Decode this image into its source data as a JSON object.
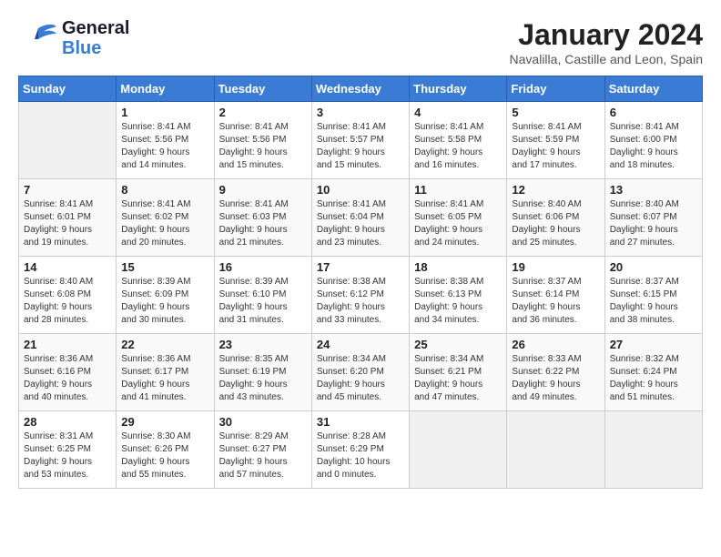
{
  "header": {
    "logo_line1": "General",
    "logo_line2": "Blue",
    "month_title": "January 2024",
    "subtitle": "Navalilla, Castille and Leon, Spain"
  },
  "weekdays": [
    "Sunday",
    "Monday",
    "Tuesday",
    "Wednesday",
    "Thursday",
    "Friday",
    "Saturday"
  ],
  "rows": [
    [
      {
        "day": "",
        "sunrise": "",
        "sunset": "",
        "daylight": ""
      },
      {
        "day": "1",
        "sunrise": "Sunrise: 8:41 AM",
        "sunset": "Sunset: 5:56 PM",
        "daylight": "Daylight: 9 hours and 14 minutes."
      },
      {
        "day": "2",
        "sunrise": "Sunrise: 8:41 AM",
        "sunset": "Sunset: 5:56 PM",
        "daylight": "Daylight: 9 hours and 15 minutes."
      },
      {
        "day": "3",
        "sunrise": "Sunrise: 8:41 AM",
        "sunset": "Sunset: 5:57 PM",
        "daylight": "Daylight: 9 hours and 15 minutes."
      },
      {
        "day": "4",
        "sunrise": "Sunrise: 8:41 AM",
        "sunset": "Sunset: 5:58 PM",
        "daylight": "Daylight: 9 hours and 16 minutes."
      },
      {
        "day": "5",
        "sunrise": "Sunrise: 8:41 AM",
        "sunset": "Sunset: 5:59 PM",
        "daylight": "Daylight: 9 hours and 17 minutes."
      },
      {
        "day": "6",
        "sunrise": "Sunrise: 8:41 AM",
        "sunset": "Sunset: 6:00 PM",
        "daylight": "Daylight: 9 hours and 18 minutes."
      }
    ],
    [
      {
        "day": "7",
        "sunrise": "Sunrise: 8:41 AM",
        "sunset": "Sunset: 6:01 PM",
        "daylight": "Daylight: 9 hours and 19 minutes."
      },
      {
        "day": "8",
        "sunrise": "Sunrise: 8:41 AM",
        "sunset": "Sunset: 6:02 PM",
        "daylight": "Daylight: 9 hours and 20 minutes."
      },
      {
        "day": "9",
        "sunrise": "Sunrise: 8:41 AM",
        "sunset": "Sunset: 6:03 PM",
        "daylight": "Daylight: 9 hours and 21 minutes."
      },
      {
        "day": "10",
        "sunrise": "Sunrise: 8:41 AM",
        "sunset": "Sunset: 6:04 PM",
        "daylight": "Daylight: 9 hours and 23 minutes."
      },
      {
        "day": "11",
        "sunrise": "Sunrise: 8:41 AM",
        "sunset": "Sunset: 6:05 PM",
        "daylight": "Daylight: 9 hours and 24 minutes."
      },
      {
        "day": "12",
        "sunrise": "Sunrise: 8:40 AM",
        "sunset": "Sunset: 6:06 PM",
        "daylight": "Daylight: 9 hours and 25 minutes."
      },
      {
        "day": "13",
        "sunrise": "Sunrise: 8:40 AM",
        "sunset": "Sunset: 6:07 PM",
        "daylight": "Daylight: 9 hours and 27 minutes."
      }
    ],
    [
      {
        "day": "14",
        "sunrise": "Sunrise: 8:40 AM",
        "sunset": "Sunset: 6:08 PM",
        "daylight": "Daylight: 9 hours and 28 minutes."
      },
      {
        "day": "15",
        "sunrise": "Sunrise: 8:39 AM",
        "sunset": "Sunset: 6:09 PM",
        "daylight": "Daylight: 9 hours and 30 minutes."
      },
      {
        "day": "16",
        "sunrise": "Sunrise: 8:39 AM",
        "sunset": "Sunset: 6:10 PM",
        "daylight": "Daylight: 9 hours and 31 minutes."
      },
      {
        "day": "17",
        "sunrise": "Sunrise: 8:38 AM",
        "sunset": "Sunset: 6:12 PM",
        "daylight": "Daylight: 9 hours and 33 minutes."
      },
      {
        "day": "18",
        "sunrise": "Sunrise: 8:38 AM",
        "sunset": "Sunset: 6:13 PM",
        "daylight": "Daylight: 9 hours and 34 minutes."
      },
      {
        "day": "19",
        "sunrise": "Sunrise: 8:37 AM",
        "sunset": "Sunset: 6:14 PM",
        "daylight": "Daylight: 9 hours and 36 minutes."
      },
      {
        "day": "20",
        "sunrise": "Sunrise: 8:37 AM",
        "sunset": "Sunset: 6:15 PM",
        "daylight": "Daylight: 9 hours and 38 minutes."
      }
    ],
    [
      {
        "day": "21",
        "sunrise": "Sunrise: 8:36 AM",
        "sunset": "Sunset: 6:16 PM",
        "daylight": "Daylight: 9 hours and 40 minutes."
      },
      {
        "day": "22",
        "sunrise": "Sunrise: 8:36 AM",
        "sunset": "Sunset: 6:17 PM",
        "daylight": "Daylight: 9 hours and 41 minutes."
      },
      {
        "day": "23",
        "sunrise": "Sunrise: 8:35 AM",
        "sunset": "Sunset: 6:19 PM",
        "daylight": "Daylight: 9 hours and 43 minutes."
      },
      {
        "day": "24",
        "sunrise": "Sunrise: 8:34 AM",
        "sunset": "Sunset: 6:20 PM",
        "daylight": "Daylight: 9 hours and 45 minutes."
      },
      {
        "day": "25",
        "sunrise": "Sunrise: 8:34 AM",
        "sunset": "Sunset: 6:21 PM",
        "daylight": "Daylight: 9 hours and 47 minutes."
      },
      {
        "day": "26",
        "sunrise": "Sunrise: 8:33 AM",
        "sunset": "Sunset: 6:22 PM",
        "daylight": "Daylight: 9 hours and 49 minutes."
      },
      {
        "day": "27",
        "sunrise": "Sunrise: 8:32 AM",
        "sunset": "Sunset: 6:24 PM",
        "daylight": "Daylight: 9 hours and 51 minutes."
      }
    ],
    [
      {
        "day": "28",
        "sunrise": "Sunrise: 8:31 AM",
        "sunset": "Sunset: 6:25 PM",
        "daylight": "Daylight: 9 hours and 53 minutes."
      },
      {
        "day": "29",
        "sunrise": "Sunrise: 8:30 AM",
        "sunset": "Sunset: 6:26 PM",
        "daylight": "Daylight: 9 hours and 55 minutes."
      },
      {
        "day": "30",
        "sunrise": "Sunrise: 8:29 AM",
        "sunset": "Sunset: 6:27 PM",
        "daylight": "Daylight: 9 hours and 57 minutes."
      },
      {
        "day": "31",
        "sunrise": "Sunrise: 8:28 AM",
        "sunset": "Sunset: 6:29 PM",
        "daylight": "Daylight: 10 hours and 0 minutes."
      },
      {
        "day": "",
        "sunrise": "",
        "sunset": "",
        "daylight": ""
      },
      {
        "day": "",
        "sunrise": "",
        "sunset": "",
        "daylight": ""
      },
      {
        "day": "",
        "sunrise": "",
        "sunset": "",
        "daylight": ""
      }
    ]
  ]
}
